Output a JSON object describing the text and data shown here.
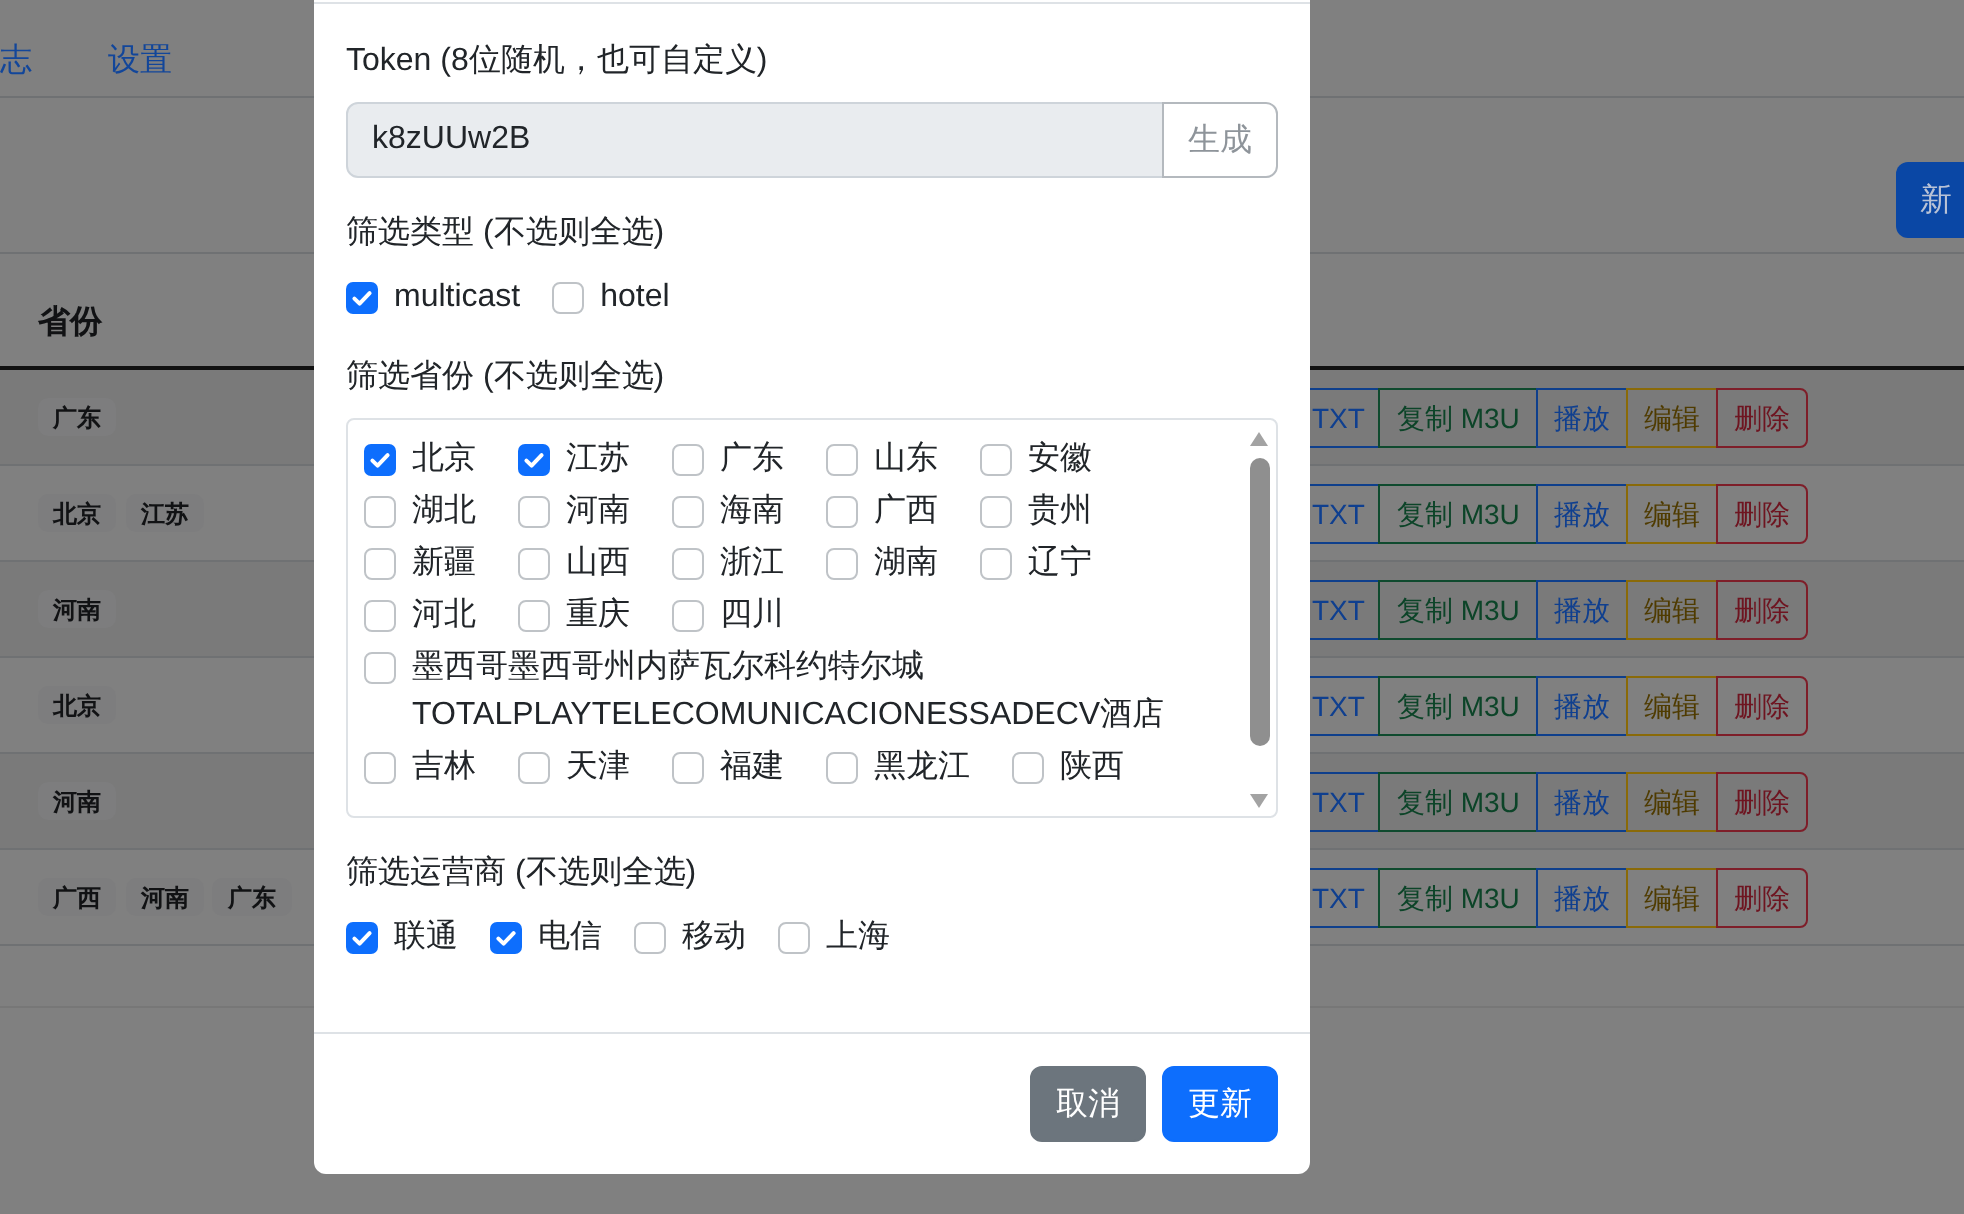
{
  "nav": {
    "items": [
      {
        "label": "志"
      },
      {
        "label": "设置"
      }
    ]
  },
  "toolbar": {
    "button": "新"
  },
  "table": {
    "header": "省份",
    "rows": [
      {
        "provinces": [
          "广东"
        ],
        "actions": [
          {
            "label": "TXT",
            "kind": "primary"
          },
          {
            "label": "复制 M3U",
            "kind": "success"
          },
          {
            "label": "播放",
            "kind": "primary"
          },
          {
            "label": "编辑",
            "kind": "warning"
          },
          {
            "label": "删除",
            "kind": "danger"
          }
        ]
      },
      {
        "provinces": [
          "北京",
          "江苏"
        ],
        "actions": [
          {
            "label": "TXT",
            "kind": "primary"
          },
          {
            "label": "复制 M3U",
            "kind": "success"
          },
          {
            "label": "播放",
            "kind": "primary"
          },
          {
            "label": "编辑",
            "kind": "warning"
          },
          {
            "label": "删除",
            "kind": "danger"
          }
        ]
      },
      {
        "provinces": [
          "河南"
        ],
        "actions": [
          {
            "label": "TXT",
            "kind": "primary"
          },
          {
            "label": "复制 M3U",
            "kind": "success"
          },
          {
            "label": "播放",
            "kind": "primary"
          },
          {
            "label": "编辑",
            "kind": "warning"
          },
          {
            "label": "删除",
            "kind": "danger"
          }
        ]
      },
      {
        "provinces": [
          "北京"
        ],
        "actions": [
          {
            "label": "TXT",
            "kind": "primary"
          },
          {
            "label": "复制 M3U",
            "kind": "success"
          },
          {
            "label": "播放",
            "kind": "primary"
          },
          {
            "label": "编辑",
            "kind": "warning"
          },
          {
            "label": "删除",
            "kind": "danger"
          }
        ]
      },
      {
        "provinces": [
          "河南"
        ],
        "actions": [
          {
            "label": "TXT",
            "kind": "primary"
          },
          {
            "label": "复制 M3U",
            "kind": "success"
          },
          {
            "label": "播放",
            "kind": "primary"
          },
          {
            "label": "编辑",
            "kind": "warning"
          },
          {
            "label": "删除",
            "kind": "danger"
          }
        ]
      },
      {
        "provinces": [
          "广西",
          "河南",
          "广东"
        ],
        "actions": [
          {
            "label": "TXT",
            "kind": "primary"
          },
          {
            "label": "复制 M3U",
            "kind": "success"
          },
          {
            "label": "播放",
            "kind": "primary"
          },
          {
            "label": "编辑",
            "kind": "warning"
          },
          {
            "label": "删除",
            "kind": "danger"
          }
        ]
      }
    ]
  },
  "modal": {
    "token": {
      "label": "Token (8位随机，也可自定义)",
      "value": "k8zUUw2B",
      "readonly": true,
      "button": {
        "label": "生成",
        "disabled": true
      }
    },
    "types": {
      "label": "筛选类型 (不选则全选)",
      "options": [
        {
          "label": "multicast",
          "checked": true
        },
        {
          "label": "hotel",
          "checked": false
        }
      ]
    },
    "provinces": {
      "label": "筛选省份 (不选则全选)",
      "options": [
        {
          "label": "北京",
          "checked": true
        },
        {
          "label": "江苏",
          "checked": true
        },
        {
          "label": "广东",
          "checked": false
        },
        {
          "label": "山东",
          "checked": false
        },
        {
          "label": "安徽",
          "checked": false
        },
        {
          "label": "湖北",
          "checked": false
        },
        {
          "label": "河南",
          "checked": false
        },
        {
          "label": "海南",
          "checked": false
        },
        {
          "label": "广西",
          "checked": false
        },
        {
          "label": "贵州",
          "checked": false
        },
        {
          "label": "新疆",
          "checked": false
        },
        {
          "label": "山西",
          "checked": false
        },
        {
          "label": "浙江",
          "checked": false
        },
        {
          "label": "湖南",
          "checked": false
        },
        {
          "label": "辽宁",
          "checked": false
        },
        {
          "label": "河北",
          "checked": false
        },
        {
          "label": "重庆",
          "checked": false
        },
        {
          "label": "四川",
          "checked": false
        },
        {
          "label": "墨西哥墨西哥州内萨瓦尔科约特尔城TOTALPLAYTELECOMUNICACIONESSADECV酒店",
          "checked": false
        },
        {
          "label": "吉林",
          "checked": false
        },
        {
          "label": "天津",
          "checked": false
        },
        {
          "label": "福建",
          "checked": false
        },
        {
          "label": "黑龙江",
          "checked": false
        },
        {
          "label": "陕西",
          "checked": false
        }
      ]
    },
    "carriers": {
      "label": "筛选运营商 (不选则全选)",
      "options": [
        {
          "label": "联通",
          "checked": true
        },
        {
          "label": "电信",
          "checked": true
        },
        {
          "label": "移动",
          "checked": false
        },
        {
          "label": "上海",
          "checked": false
        }
      ]
    },
    "buttons": [
      {
        "label": "取消",
        "kind": "secondary"
      },
      {
        "label": "更新",
        "kind": "primary"
      }
    ]
  }
}
